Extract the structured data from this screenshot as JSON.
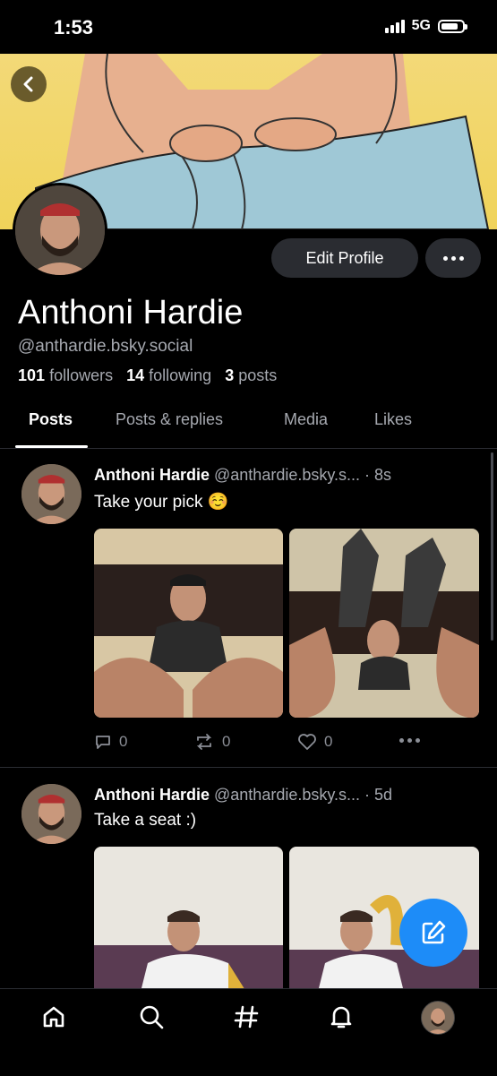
{
  "status_bar": {
    "time": "1:53",
    "network": "5G",
    "battery_level": 0.8
  },
  "profile": {
    "name": "Anthoni Hardie",
    "handle": "@anthardie.bsky.social",
    "followers_count": "101",
    "followers_label": "followers",
    "following_count": "14",
    "following_label": "following",
    "posts_count": "3",
    "posts_label": "posts",
    "edit_label": "Edit Profile"
  },
  "tabs": [
    {
      "label": "Posts",
      "active": true
    },
    {
      "label": "Posts & replies",
      "active": false
    },
    {
      "label": "Media",
      "active": false
    },
    {
      "label": "Likes",
      "active": false
    }
  ],
  "posts": [
    {
      "author": "Anthoni Hardie",
      "meta": "@anthardie.bsky.s... · 8s",
      "text": "Take your pick ☺️",
      "replies": "0",
      "reposts": "0",
      "likes": "0"
    },
    {
      "author": "Anthoni Hardie",
      "meta": "@anthardie.bsky.s... · 5d",
      "text": "Take a seat :)"
    }
  ],
  "icons": {
    "back": "chevron-left-icon",
    "more": "more-horizontal-icon",
    "reply": "speech-bubble-icon",
    "repost": "repost-icon",
    "like": "heart-icon",
    "compose": "compose-icon",
    "home": "home-icon",
    "search": "search-icon",
    "feeds": "hashtag-icon",
    "notifications": "bell-icon"
  },
  "colors": {
    "background": "#000000",
    "accent": "#1d8cf8",
    "muted_text": "#a6a9b0",
    "button_bg": "#2a2c31"
  }
}
